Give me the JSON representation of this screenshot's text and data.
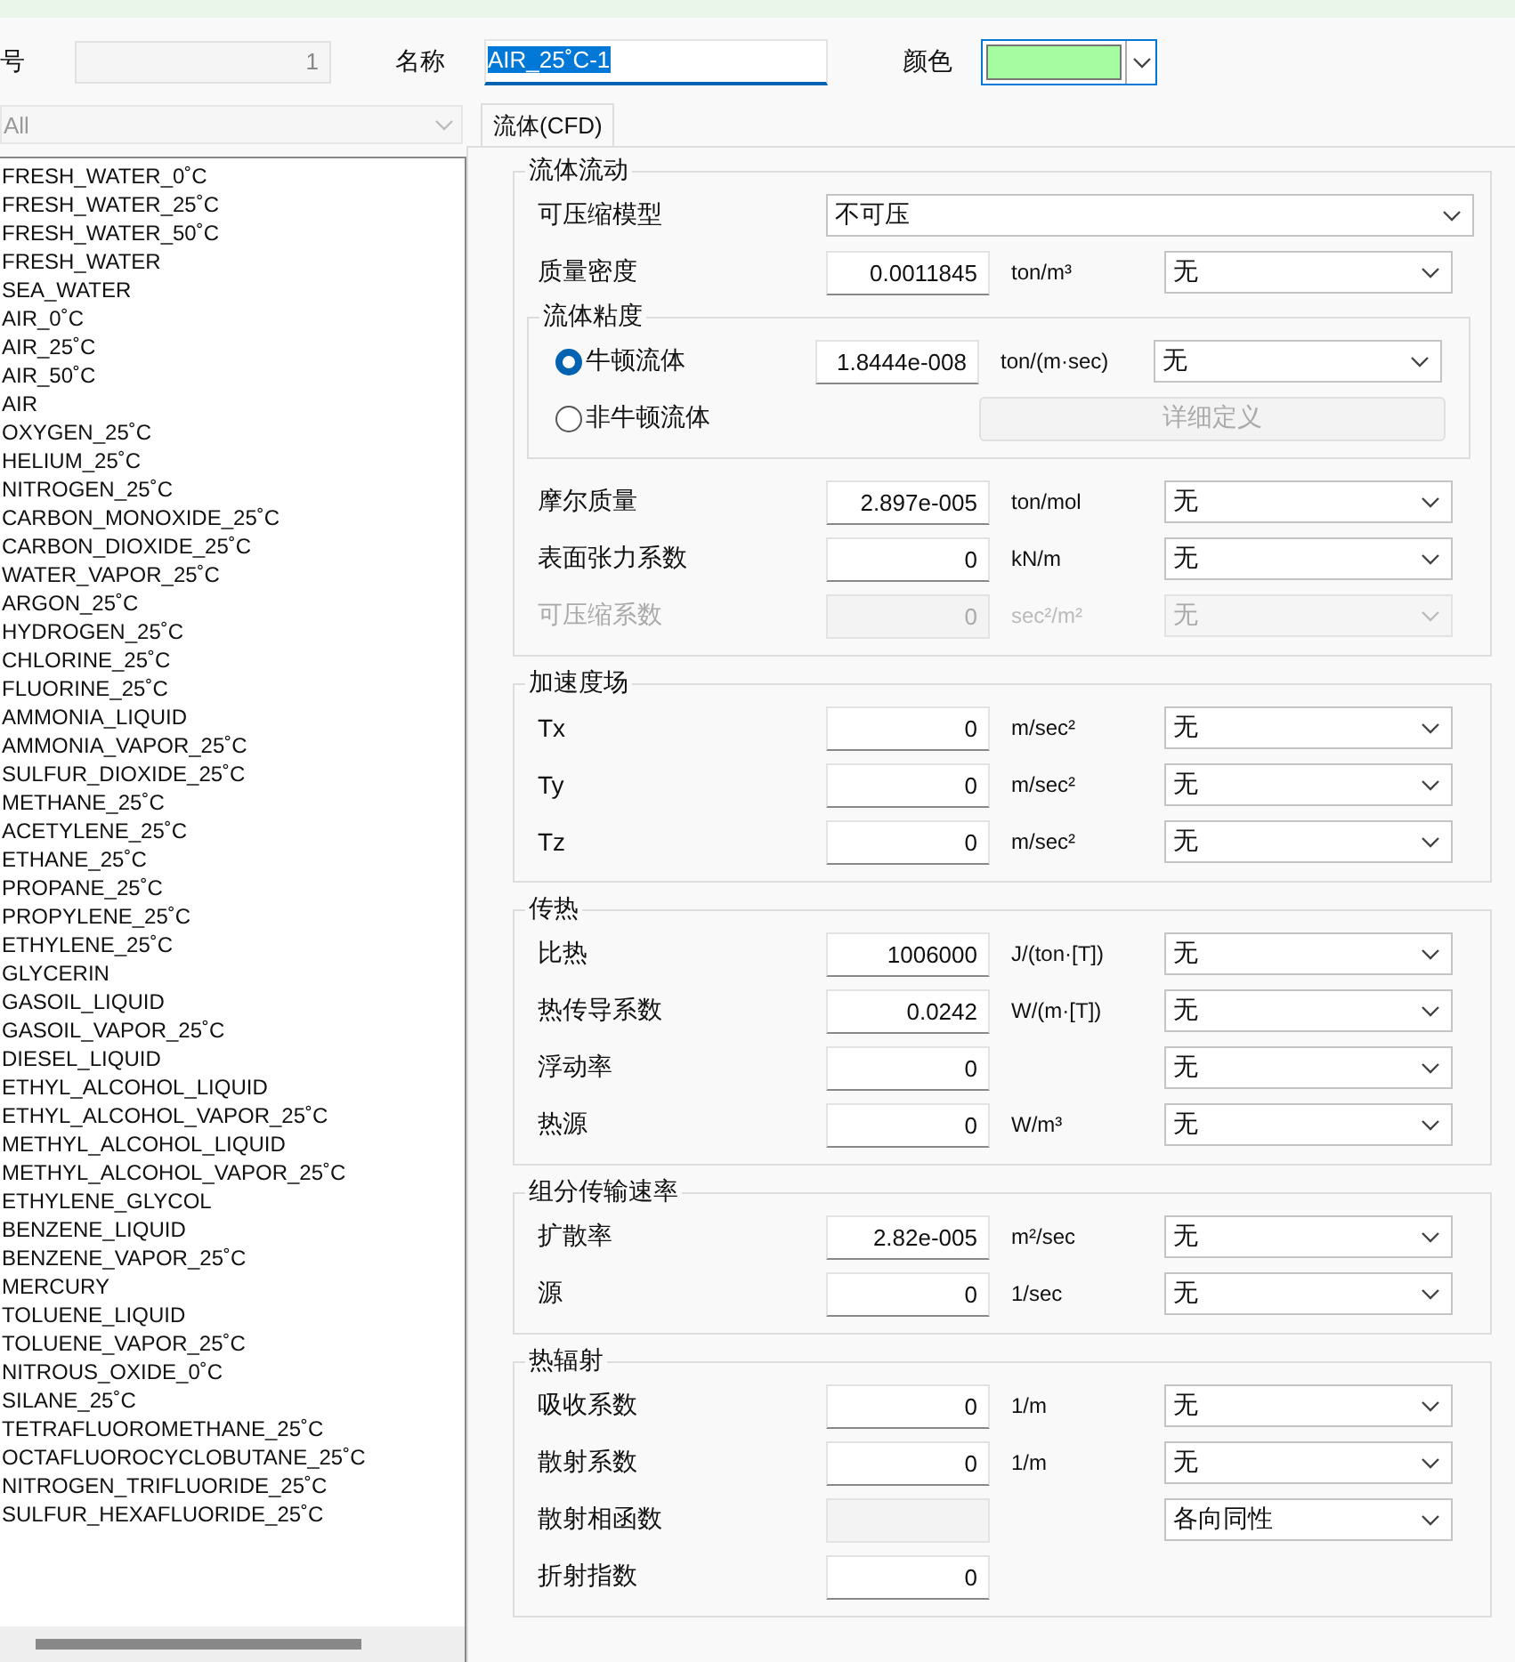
{
  "header": {
    "index_label": "号",
    "index_value": "1",
    "name_label": "名称",
    "name_value": "AIR_25˚C-1",
    "name_text_selected": true,
    "color_label": "颜色",
    "color": "#a6fca0"
  },
  "filter": {
    "value": "All",
    "disabled": true
  },
  "materials": [
    "FRESH_WATER_0˚C",
    "FRESH_WATER_25˚C",
    "FRESH_WATER_50˚C",
    "FRESH_WATER",
    "SEA_WATER",
    "AIR_0˚C",
    "AIR_25˚C",
    "AIR_50˚C",
    "AIR",
    "OXYGEN_25˚C",
    "HELIUM_25˚C",
    "NITROGEN_25˚C",
    "CARBON_MONOXIDE_25˚C",
    "CARBON_DIOXIDE_25˚C",
    "WATER_VAPOR_25˚C",
    "ARGON_25˚C",
    "HYDROGEN_25˚C",
    "CHLORINE_25˚C",
    "FLUORINE_25˚C",
    "AMMONIA_LIQUID",
    "AMMONIA_VAPOR_25˚C",
    "SULFUR_DIOXIDE_25˚C",
    "METHANE_25˚C",
    "ACETYLENE_25˚C",
    "ETHANE_25˚C",
    "PROPANE_25˚C",
    "PROPYLENE_25˚C",
    "ETHYLENE_25˚C",
    "GLYCERIN",
    "GASOIL_LIQUID",
    "GASOIL_VAPOR_25˚C",
    "DIESEL_LIQUID",
    "ETHYL_ALCOHOL_LIQUID",
    "ETHYL_ALCOHOL_VAPOR_25˚C",
    "METHYL_ALCOHOL_LIQUID",
    "METHYL_ALCOHOL_VAPOR_25˚C",
    "ETHYLENE_GLYCOL",
    "BENZENE_LIQUID",
    "BENZENE_VAPOR_25˚C",
    "MERCURY",
    "TOLUENE_LIQUID",
    "TOLUENE_VAPOR_25˚C",
    "NITROUS_OXIDE_0˚C",
    "SILANE_25˚C",
    "TETRAFLUOROMETHANE_25˚C",
    "OCTAFLUOROCYCLOBUTANE_25˚C",
    "NITROGEN_TRIFLUORIDE_25˚C",
    "SULFUR_HEXAFLUORIDE_25˚C"
  ],
  "tabs": [
    {
      "label": "流体(CFD)",
      "selected": true
    }
  ],
  "groups": [
    {
      "title": "流体流动",
      "rows": [
        {
          "kind": "wide-select",
          "label": "可压缩模型",
          "option": "不可压"
        },
        {
          "kind": "field",
          "label": "质量密度",
          "value": "0.0011845",
          "unit": "ton/m³",
          "option": "无"
        },
        {
          "kind": "subgroup",
          "title": "流体粘度",
          "rows": [
            {
              "kind": "radio",
              "label": "牛顿流体",
              "selected": true,
              "value": "1.8444e-008",
              "unit": "ton/(m·sec)",
              "option": "无"
            },
            {
              "kind": "radio",
              "label": "非牛顿流体",
              "selected": false,
              "button": "详细定义",
              "button_disabled": true
            }
          ]
        },
        {
          "kind": "field",
          "label": "摩尔质量",
          "value": "2.897e-005",
          "unit": "ton/mol",
          "option": "无"
        },
        {
          "kind": "field",
          "label": "表面张力系数",
          "value": "0",
          "unit": "kN/m",
          "option": "无"
        },
        {
          "kind": "field",
          "label": "可压缩系数",
          "value": "0",
          "unit": "sec²/m²",
          "option": "无",
          "disabled": true
        }
      ]
    },
    {
      "title": "加速度场",
      "rows": [
        {
          "kind": "field",
          "label": "Tx",
          "value": "0",
          "unit": "m/sec²",
          "option": "无"
        },
        {
          "kind": "field",
          "label": "Ty",
          "value": "0",
          "unit": "m/sec²",
          "option": "无"
        },
        {
          "kind": "field",
          "label": "Tz",
          "value": "0",
          "unit": "m/sec²",
          "option": "无"
        }
      ]
    },
    {
      "title": "传热",
      "rows": [
        {
          "kind": "field",
          "label": "比热",
          "value": "1006000",
          "unit": "J/(ton·[T])",
          "option": "无"
        },
        {
          "kind": "field",
          "label": "热传导系数",
          "value": "0.0242",
          "unit": "W/(m·[T])",
          "option": "无"
        },
        {
          "kind": "field",
          "label": "浮动率",
          "value": "0",
          "option": "无"
        },
        {
          "kind": "field",
          "label": "热源",
          "value": "0",
          "unit": "W/m³",
          "option": "无"
        }
      ]
    },
    {
      "title": "组分传输速率",
      "rows": [
        {
          "kind": "field",
          "label": "扩散率",
          "value": "2.82e-005",
          "unit": "m²/sec",
          "option": "无"
        },
        {
          "kind": "field",
          "label": "源",
          "value": "0",
          "unit": "1/sec",
          "option": "无"
        }
      ]
    },
    {
      "title": "热辐射",
      "rows": [
        {
          "kind": "field",
          "label": "吸收系数",
          "value": "0",
          "unit": "1/m",
          "option": "无"
        },
        {
          "kind": "field",
          "label": "散射系数",
          "value": "0",
          "unit": "1/m",
          "option": "无"
        },
        {
          "kind": "field",
          "label": "散射相函数",
          "value_disabled": true,
          "option": "各向同性"
        },
        {
          "kind": "field",
          "label": "折射指数",
          "value": "0"
        }
      ]
    }
  ]
}
